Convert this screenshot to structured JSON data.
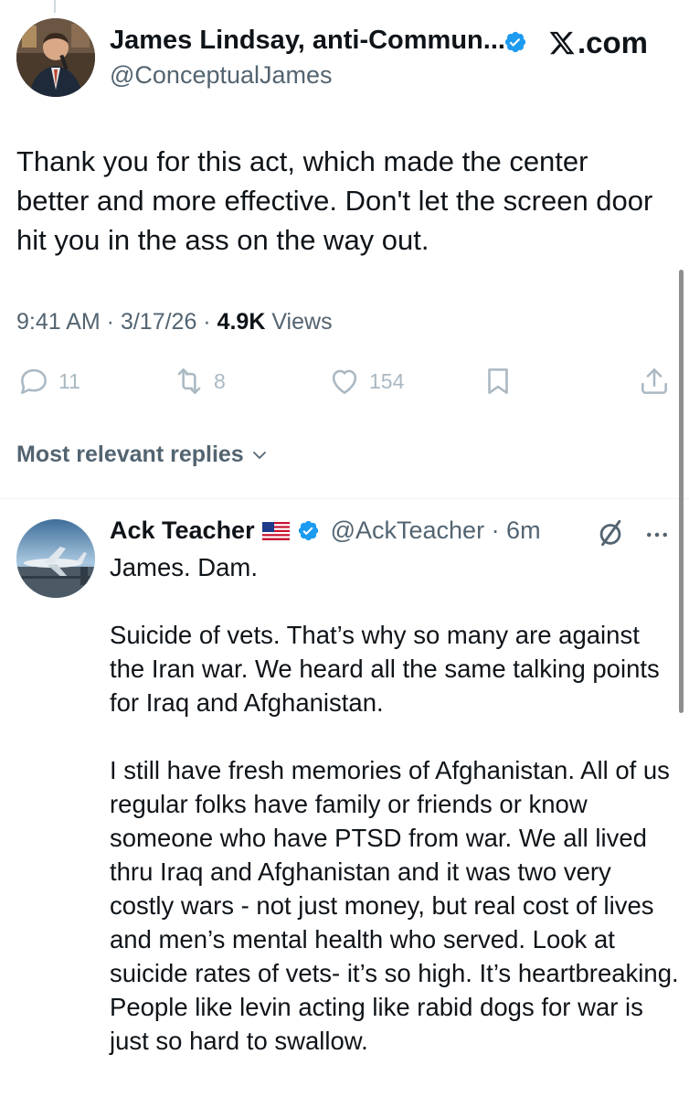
{
  "tweet": {
    "author_name": "James Lindsay, anti-Commun...",
    "author_handle": "@ConceptualJames",
    "brand": ".com",
    "text": "Thank you for this act, which made the center better and more effective. Don't let the screen door hit you in the ass on the way out.",
    "time": "9:41 AM · 3/17/26 · ",
    "views_count": "4.9K",
    "views_label": " Views",
    "replies": "11",
    "reposts": "8",
    "likes": "154"
  },
  "sort": {
    "label": "Most relevant replies"
  },
  "reply": {
    "name": "Ack Teacher",
    "handle": "@AckTeacher · 6m",
    "paragraphs": [
      "James.  Dam.",
      "Suicide of vets.  That’s why so many are against the Iran war.  We heard all the same talking points for Iraq and Afghanistan.",
      " I still have fresh memories of Afghanistan.  All of us regular folks have family or friends or know someone who have PTSD from war.  We all lived  thru Iraq and Afghanistan and it was two very costly wars - not just money, but real cost of lives and men’s mental health who served.   Look at suicide rates of vets- it’s so high.  It’s heartbreaking.  People like levin acting like rabid dogs for war is just so hard to swallow."
    ]
  },
  "colors": {
    "text_primary": "#0f1419",
    "text_secondary": "#536471",
    "icon_muted": "#aab8c2",
    "verified_blue": "#1d9bf0",
    "divider": "#eff3f4"
  },
  "icons": {
    "reply": "speech-bubble-icon",
    "repost": "repost-arrows-icon",
    "like": "heart-icon",
    "bookmark": "bookmark-icon",
    "share": "share-upload-icon",
    "grok": "grok-slash-circle-icon",
    "more": "ellipsis-icon",
    "verified": "verified-badge-icon",
    "brand": "x-logo-icon",
    "flag": "us-flag-icon"
  }
}
